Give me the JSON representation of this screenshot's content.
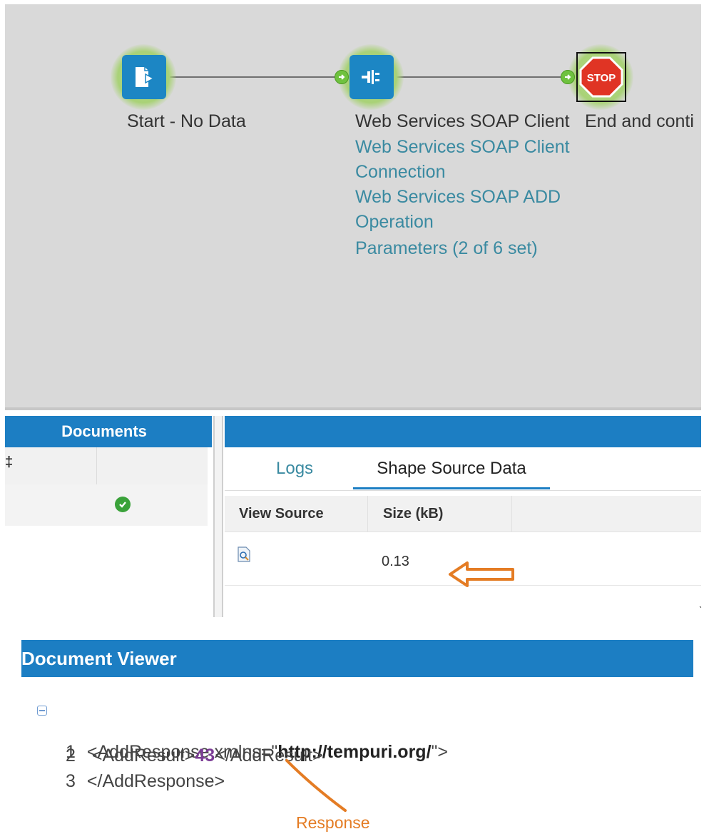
{
  "process": {
    "nodes": [
      {
        "id": "start",
        "title": "Start - No Data",
        "icon": "document-arrow-icon"
      },
      {
        "id": "soap",
        "title": "Web Services SOAP Client",
        "icon": "plug-connector-icon",
        "links": [
          "Web Services SOAP Client",
          "Connection",
          "Web Services SOAP ADD",
          "Operation",
          "Parameters (2 of 6 set)"
        ]
      },
      {
        "id": "stop",
        "title": "End and conti",
        "icon": "stop-sign-icon",
        "stop_text": "STOP"
      }
    ]
  },
  "documents_panel": {
    "header": "Documents",
    "col_mark": "‡",
    "status_icon": "check-circle-icon"
  },
  "tabs": {
    "logs": "Logs",
    "shape_source": "Shape Source Data"
  },
  "grid": {
    "col_view_source": "View Source",
    "col_size": "Size (kB)",
    "rows": [
      {
        "view_icon": "document-view-icon",
        "size": "0.13"
      }
    ]
  },
  "viewer": {
    "title": "Document Viewer",
    "lines": [
      {
        "num": "1",
        "pre": "<AddResponse xmlns=\"",
        "bold": "http://tempuri.org/",
        "post": "\">"
      },
      {
        "num": "2",
        "pre": " <AddResult>",
        "value": "43",
        "post": "</AddResult>"
      },
      {
        "num": "3",
        "text": "</AddResponse>"
      }
    ]
  },
  "annotations": {
    "response_label": "Response",
    "color": "#e47c24"
  },
  "colors": {
    "accent": "#1c7ec3",
    "canvas_bg": "#d9d9d9",
    "link": "#3a8aa1"
  }
}
